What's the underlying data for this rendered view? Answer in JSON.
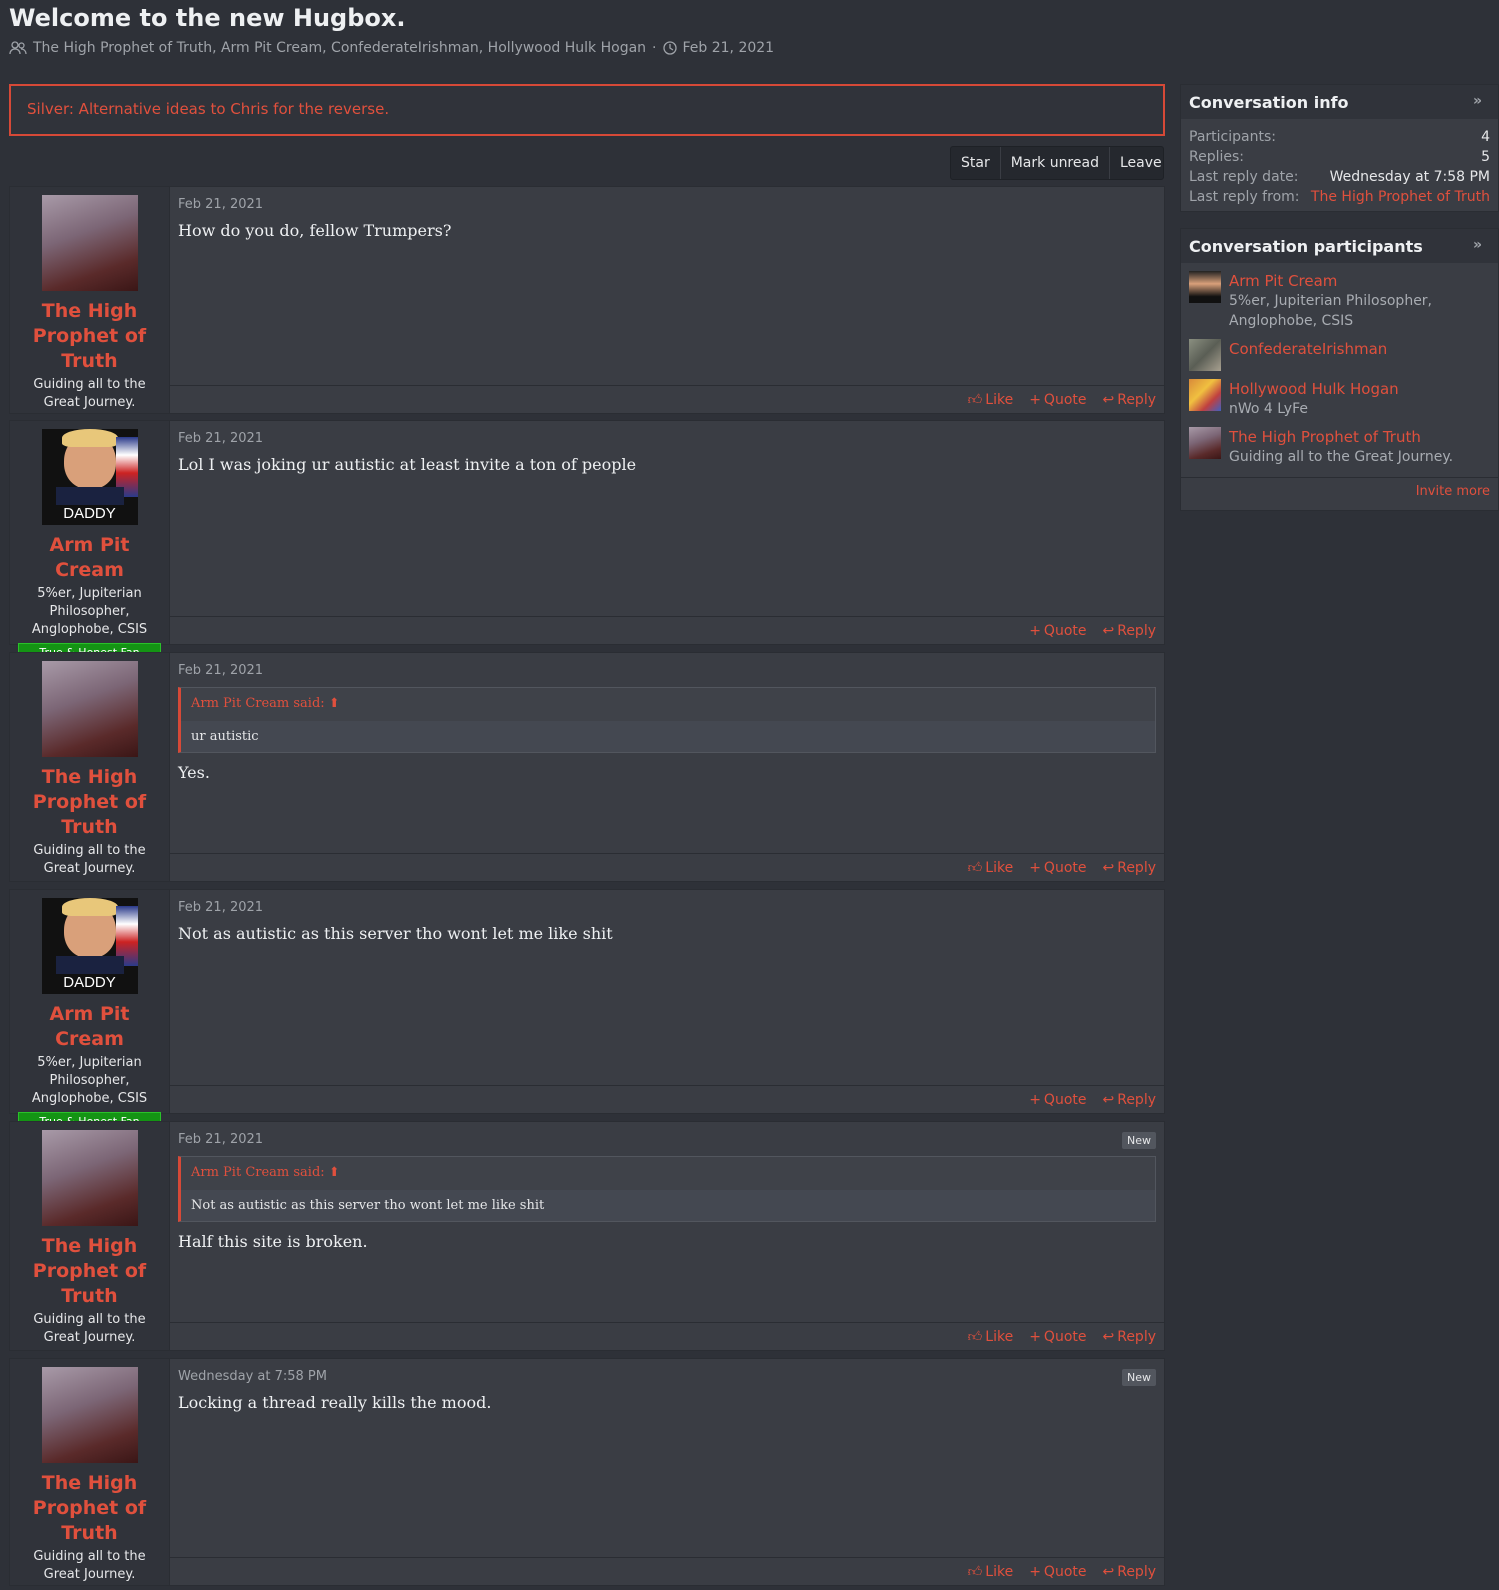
{
  "page": {
    "title": "Welcome to the new Hugbox.",
    "participants_line": "The High Prophet of Truth, Arm Pit Cream, ConfederateIrishman, Hollywood Hulk Hogan",
    "separator": "·",
    "start_date": "Feb 21, 2021",
    "notice": "Silver: Alternative ideas to Chris for the reverse."
  },
  "actions": {
    "star": "Star",
    "mark_unread": "Mark unread",
    "leave": "Leave"
  },
  "messages": [
    {
      "user": "The High Prophet of Truth",
      "user_title": "Guiding all to the Great Journey.",
      "date": "Feb 21, 2021",
      "text": "How do you do, fellow Trumpers?",
      "like": "Like",
      "quote": "Quote",
      "reply": "Reply"
    },
    {
      "user": "Arm Pit Cream",
      "user_title": "5%er, Jupiterian Philosopher, Anglophobe, CSIS",
      "banner": "True & Honest Fan",
      "avatar_caption": "DADDY",
      "date": "Feb 21, 2021",
      "text": "Lol I was joking ur autistic at least invite a ton of people",
      "quote": "Quote",
      "reply": "Reply"
    },
    {
      "user": "The High Prophet of Truth",
      "user_title": "Guiding all to the Great Journey.",
      "date": "Feb 21, 2021",
      "quote_author": "Arm Pit Cream said:",
      "quote_text": "ur autistic",
      "text": "Yes.",
      "like": "Like",
      "quote": "Quote",
      "reply": "Reply"
    },
    {
      "user": "Arm Pit Cream",
      "user_title": "5%er, Jupiterian Philosopher, Anglophobe, CSIS",
      "banner": "True & Honest Fan",
      "avatar_caption": "DADDY",
      "date": "Feb 21, 2021",
      "text": "Not as autistic as this server tho wont let me like shit",
      "quote": "Quote",
      "reply": "Reply"
    },
    {
      "user": "The High Prophet of Truth",
      "user_title": "Guiding all to the Great Journey.",
      "date": "Feb 21, 2021",
      "badge": "New",
      "quote_author": "Arm Pit Cream said:",
      "quote_text": "Not as autistic as this server tho wont let me like shit",
      "text": "Half this site is broken.",
      "like": "Like",
      "quote": "Quote",
      "reply": "Reply"
    },
    {
      "user": "The High Prophet of Truth",
      "user_title": "Guiding all to the Great Journey.",
      "date": "Wednesday at 7:58 PM",
      "badge": "New",
      "text": "Locking a thread really kills the mood.",
      "like": "Like",
      "quote": "Quote",
      "reply": "Reply"
    }
  ],
  "info": {
    "heading": "Conversation info",
    "participants_label": "Participants:",
    "participants_value": "4",
    "replies_label": "Replies:",
    "replies_value": "5",
    "last_date_label": "Last reply date:",
    "last_date_value": "Wednesday at 7:58 PM",
    "last_from_label": "Last reply from:",
    "last_from_value": "The High Prophet of Truth"
  },
  "participants_box": {
    "heading": "Conversation participants",
    "items": [
      {
        "name": "Arm Pit Cream",
        "title": "5%er, Jupiterian Philosopher, Anglophobe, CSIS"
      },
      {
        "name": "ConfederateIrishman",
        "title": ""
      },
      {
        "name": "Hollywood Hulk Hogan",
        "title": "nWo 4 LyFe"
      },
      {
        "name": "The High Prophet of Truth",
        "title": "Guiding all to the Great Journey."
      }
    ],
    "invite": "Invite more"
  },
  "colors": {
    "accent": "#e0503d",
    "background": "#2e3138",
    "panel": "#3a3d44",
    "banner": "#149414"
  }
}
